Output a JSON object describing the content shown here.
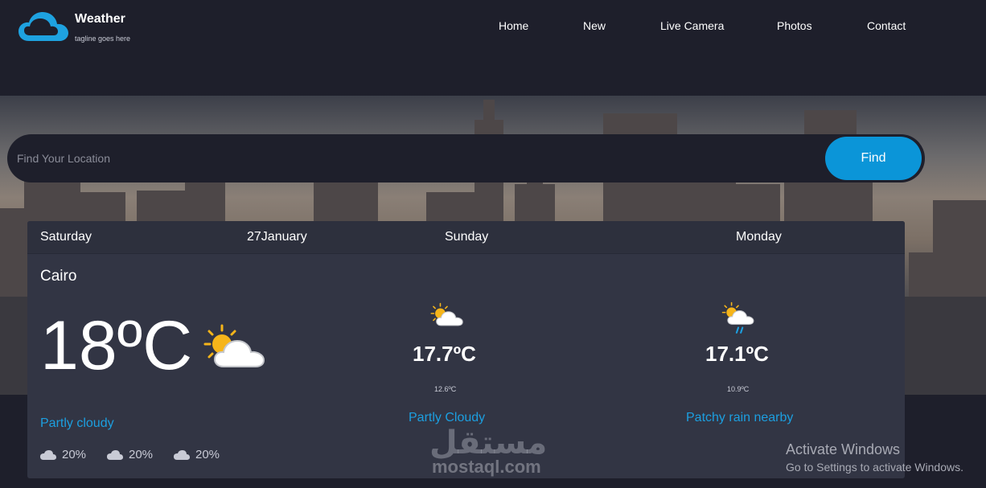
{
  "brand": {
    "title": "Weather",
    "tagline": "tagline goes here"
  },
  "nav": {
    "items": [
      {
        "label": "Home"
      },
      {
        "label": "New"
      },
      {
        "label": "Live Camera"
      },
      {
        "label": "Photos"
      },
      {
        "label": "Contact"
      }
    ]
  },
  "search": {
    "placeholder": "Find Your Location",
    "button_label": "Find"
  },
  "forecast": {
    "today": {
      "day": "Saturday",
      "date": "27January",
      "city": "Cairo",
      "temp": "18ºC",
      "condition": "Partly cloudy",
      "icon": "partly-cloudy-sun-icon",
      "stats": [
        {
          "icon": "cloud-icon",
          "value": "20%"
        },
        {
          "icon": "cloud-icon",
          "value": "20%"
        },
        {
          "icon": "cloud-icon",
          "value": "20%"
        }
      ]
    },
    "days": [
      {
        "day": "Sunday",
        "max_temp": "17.7ºC",
        "min_temp": "12.6ºC",
        "condition": "Partly Cloudy",
        "icon": "partly-cloudy-sun-icon"
      },
      {
        "day": "Monday",
        "max_temp": "17.1ºC",
        "min_temp": "10.9ºC",
        "condition": "Patchy rain nearby",
        "icon": "patchy-rain-icon"
      }
    ]
  },
  "watermark": {
    "arabic": "مستقل",
    "latin": "mostaql.com"
  },
  "os_notice": {
    "title": "Activate Windows",
    "subtitle": "Go to Settings to activate Windows."
  },
  "colors": {
    "background": "#1e1f2b",
    "panel": "#323544",
    "accent": "#0b95d8",
    "condition_text": "#1c9fe0",
    "logo_blue": "#1ea2e0"
  }
}
